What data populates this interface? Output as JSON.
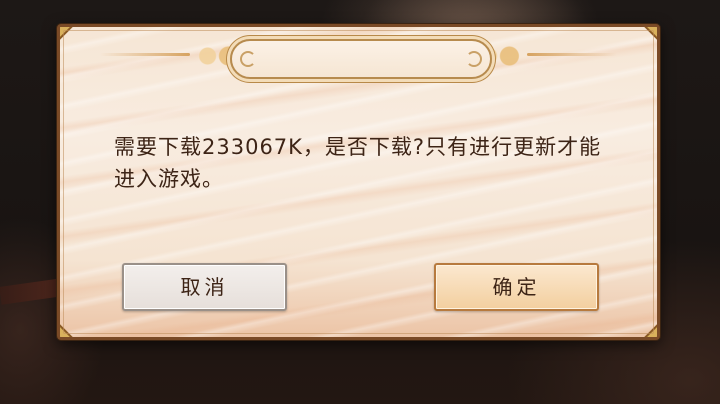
{
  "dialog": {
    "title": "",
    "message": "需要下载233067K，是否下载?只有进行更新才能进入游戏。",
    "buttons": {
      "cancel_label": "取消",
      "confirm_label": "确定"
    }
  },
  "colors": {
    "text": "#3d2416",
    "frame": "#7a4a26",
    "confirm_bg": "#f3cf9f",
    "cancel_bg": "#e6dfda"
  }
}
